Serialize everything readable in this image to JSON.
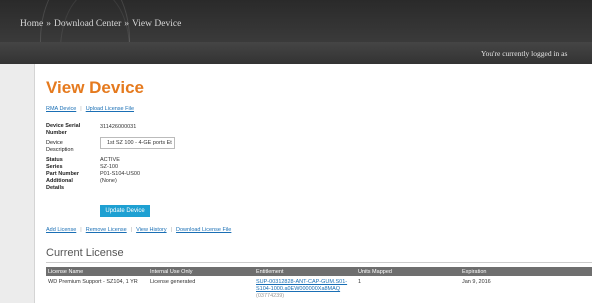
{
  "breadcrumb": {
    "home": "Home",
    "download_center": "Download Center",
    "current": "View Device",
    "separator": "»"
  },
  "header": {
    "logged_in_text": "You're currently logged in as"
  },
  "page": {
    "title": "View Device",
    "links": {
      "rma": "RMA Device",
      "upload_license": "Upload License File"
    }
  },
  "device": {
    "serial_label": "Device Serial Number",
    "serial_value": "311426000031",
    "description_label": "Device Description",
    "description_value": "1st SZ 100 - 4-GE ports Et",
    "status_label": "Status",
    "status_value": "ACTIVE",
    "series_label": "Series",
    "series_value": "SZ-100",
    "part_label": "Part Number",
    "part_value": "P01-S104-US00",
    "additional_label": "Additional Details",
    "additional_value": "(None)"
  },
  "buttons": {
    "update": "Update Device"
  },
  "actions": {
    "add_license": "Add License",
    "remove_license": "Remove License",
    "view_history": "View History",
    "download_license": "Download License File"
  },
  "license_section": {
    "title": "Current License",
    "columns": [
      "License Name",
      "Internal Use Only",
      "Entitlement",
      "Units Mapped",
      "Expiration"
    ],
    "rows": [
      {
        "name": "WD Premium Support - SZ104, 1 YR",
        "internal": "License generated",
        "entitlement_line1": "SUP-00312828-ANT-CAP-GUM.S01-",
        "entitlement_line2": "S104-1000.a0EW000000Xa8MAQ",
        "entitlement_line3": "(03774239)",
        "units": "1",
        "expiration": "Jan 9, 2016"
      }
    ]
  },
  "colors": {
    "title_orange": "#e57a1e",
    "link_blue": "#1a6fb5",
    "button_blue": "#1ea0d2",
    "table_header": "#6e6e6e"
  }
}
